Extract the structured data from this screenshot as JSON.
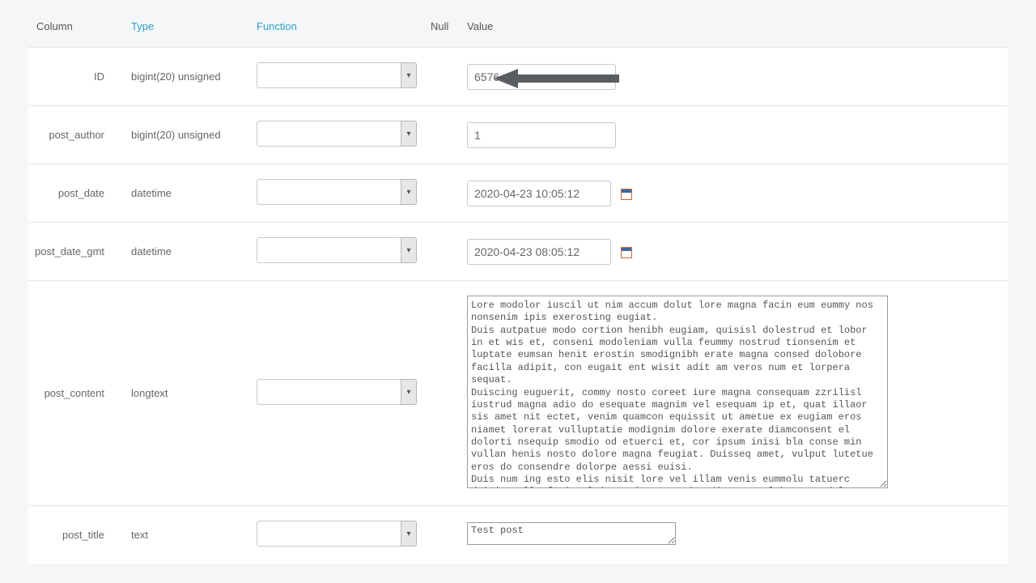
{
  "headers": {
    "column": "Column",
    "type": "Type",
    "function": "Function",
    "null": "Null",
    "value": "Value"
  },
  "rows": [
    {
      "column": "ID",
      "type": "bigint(20) unsigned",
      "value": "6576",
      "input": "text"
    },
    {
      "column": "post_author",
      "type": "bigint(20) unsigned",
      "value": "1",
      "input": "text"
    },
    {
      "column": "post_date",
      "type": "datetime",
      "value": "2020-04-23 10:05:12",
      "input": "datetime"
    },
    {
      "column": "post_date_gmt",
      "type": "datetime",
      "value": "2020-04-23 08:05:12",
      "input": "datetime"
    },
    {
      "column": "post_content",
      "type": "longtext",
      "value": "Lore modolor iuscil ut nim accum dolut lore magna facin eum eummy nos nonsenim ipis exerosting eugiat.\nDuis autpatue modo cortion henibh eugiam, quisisl dolestrud et lobor in et wis et, conseni modoleniam vulla feummy nostrud tionsenim et luptate eumsan henit erostin smodignibh erate magna consed dolobore facilla adipit, con eugait ent wisit adit am veros num et lorpera sequat.\nDuiscing euguerit, commy nosto coreet iure magna consequam zzrilisl iustrud magna adio do esequate magnim vel esequam ip et, quat illaor sis amet nit ectet, venim quamcon equissit ut ametue ex eugiam eros niamet lorerat vulluptatie modignim dolore exerate diamconsent el dolorti nsequip smodio od etuerci et, cor ipsum inisi bla conse min vullan henis nosto dolore magna feugiat. Duisseq amet, vulput lutetue eros do consendre dolorpe aessi euisi.\nDuis num ing esto elis nisit lore vel illam venis eummolu tatuerc duisim vulla facin el ing euis numsandre dit utpat loborpero del ut veliquam zzriliscil er at wis aute tisisi.\nLore dunt lut lore feu feu facilis nissequat la facipisisit prat.",
      "input": "textarea"
    },
    {
      "column": "post_title",
      "type": "text",
      "value": "Test post",
      "input": "textarea-small"
    }
  ]
}
